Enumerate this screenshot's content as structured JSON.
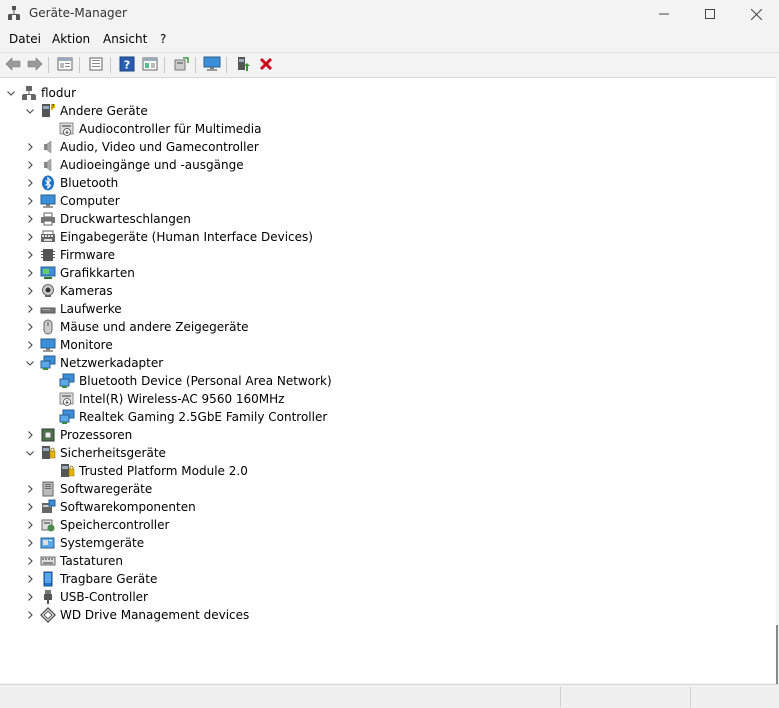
{
  "window": {
    "title": "Geräte-Manager",
    "minimize": "Minimieren",
    "maximize": "Maximieren",
    "close": "Schließen"
  },
  "menu": [
    {
      "label": "Datei"
    },
    {
      "label": "Aktion"
    },
    {
      "label": "Ansicht"
    },
    {
      "label": "?"
    }
  ],
  "toolbar": [
    "back-icon",
    "forward-icon",
    "properties-icon",
    "update-driver-icon",
    "help-icon",
    "show-hidden-icon",
    "scan-hardware-icon",
    "monitor-icon",
    "enable-device-icon",
    "uninstall-icon"
  ],
  "tree": {
    "root": "flodur",
    "items": [
      {
        "label": "Andere Geräte",
        "expanded": true,
        "icon": "unknown-device-icon",
        "children": [
          {
            "label": "Audiocontroller für Multimedia",
            "icon": "warning-device-icon"
          }
        ]
      },
      {
        "label": "Audio, Video und Gamecontroller",
        "expanded": false,
        "icon": "speaker-icon"
      },
      {
        "label": "Audioeingänge und -ausgänge",
        "expanded": false,
        "icon": "speaker-icon"
      },
      {
        "label": "Bluetooth",
        "expanded": false,
        "icon": "bluetooth-icon"
      },
      {
        "label": "Computer",
        "expanded": false,
        "icon": "computer-icon"
      },
      {
        "label": "Druckwarteschlangen",
        "expanded": false,
        "icon": "printer-icon"
      },
      {
        "label": "Eingabegeräte (Human Interface Devices)",
        "expanded": false,
        "icon": "hid-icon"
      },
      {
        "label": "Firmware",
        "expanded": false,
        "icon": "firmware-icon"
      },
      {
        "label": "Grafikkarten",
        "expanded": false,
        "icon": "display-adapter-icon"
      },
      {
        "label": "Kameras",
        "expanded": false,
        "icon": "camera-icon"
      },
      {
        "label": "Laufwerke",
        "expanded": false,
        "icon": "disk-drive-icon"
      },
      {
        "label": "Mäuse und andere Zeigegeräte",
        "expanded": false,
        "icon": "mouse-icon"
      },
      {
        "label": "Monitore",
        "expanded": false,
        "icon": "monitor-icon"
      },
      {
        "label": "Netzwerkadapter",
        "expanded": true,
        "icon": "network-icon",
        "children": [
          {
            "label": "Bluetooth Device (Personal Area Network)",
            "icon": "network-icon"
          },
          {
            "label": "Intel(R) Wireless-AC 9560 160MHz",
            "icon": "network-warning-icon"
          },
          {
            "label": "Realtek Gaming 2.5GbE Family Controller",
            "icon": "network-icon"
          }
        ]
      },
      {
        "label": "Prozessoren",
        "expanded": false,
        "icon": "processor-icon"
      },
      {
        "label": "Sicherheitsgeräte",
        "expanded": true,
        "icon": "security-icon",
        "children": [
          {
            "label": "Trusted Platform Module 2.0",
            "icon": "security-icon"
          }
        ]
      },
      {
        "label": "Softwaregeräte",
        "expanded": false,
        "icon": "software-device-icon"
      },
      {
        "label": "Softwarekomponenten",
        "expanded": false,
        "icon": "software-component-icon"
      },
      {
        "label": "Speichercontroller",
        "expanded": false,
        "icon": "storage-controller-icon"
      },
      {
        "label": "Systemgeräte",
        "expanded": false,
        "icon": "system-device-icon"
      },
      {
        "label": "Tastaturen",
        "expanded": false,
        "icon": "keyboard-icon"
      },
      {
        "label": "Tragbare Geräte",
        "expanded": false,
        "icon": "portable-device-icon"
      },
      {
        "label": "USB-Controller",
        "expanded": false,
        "icon": "usb-icon"
      },
      {
        "label": "WD Drive Management devices",
        "expanded": false,
        "icon": "wd-drive-icon"
      }
    ]
  },
  "colors": {
    "window_bg": "#f3f3f3",
    "tree_bg": "#ffffff",
    "accent_blue": "#1a73c8",
    "uninstall_red": "#d0021b"
  }
}
